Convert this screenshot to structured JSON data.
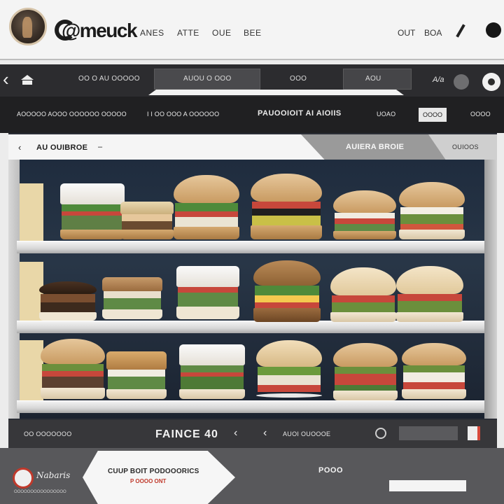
{
  "header": {
    "logo": "@meuck",
    "nav": [
      "ANES",
      "ATTE",
      "OUE",
      "BEE"
    ],
    "right_links": [
      "OUT",
      "BOA"
    ]
  },
  "toolbar": {
    "left_text": "OO O AU OOOOO",
    "tabs": [
      "AUOU O OOO",
      "OOO",
      "AOU"
    ],
    "pen_label": "A/a"
  },
  "filterbar": {
    "items": [
      "AOOOOO AOOO OOOOOO OOOOO",
      "I I OO OOO A OOOOOO",
      "PAUOOIOIT AI AIOIIS",
      "UOAO",
      "OOOO",
      "OOOO"
    ]
  },
  "panel": {
    "back_label": "AU OUIBROE",
    "dash": "–",
    "right_title": "AUIERA BROIE",
    "right_sub": "OUIOOS"
  },
  "bottombar": {
    "left_text": "OO OOOOOOO",
    "title": "FAINCE 40",
    "center_text": "AUOI OUOOOE"
  },
  "footer": {
    "logo_text": "Nabaris",
    "logo_sub": "OOOOOOOOOOOOOOOO",
    "speech_title": "CUUP BOIT PODOOORICS",
    "speech_sub": "P OOOO ONT",
    "label": "POOO"
  },
  "colors": {
    "accent": "#c0392b",
    "dark": "#202022",
    "lettuce": "#4f8a3a",
    "tomato": "#c7473b"
  }
}
